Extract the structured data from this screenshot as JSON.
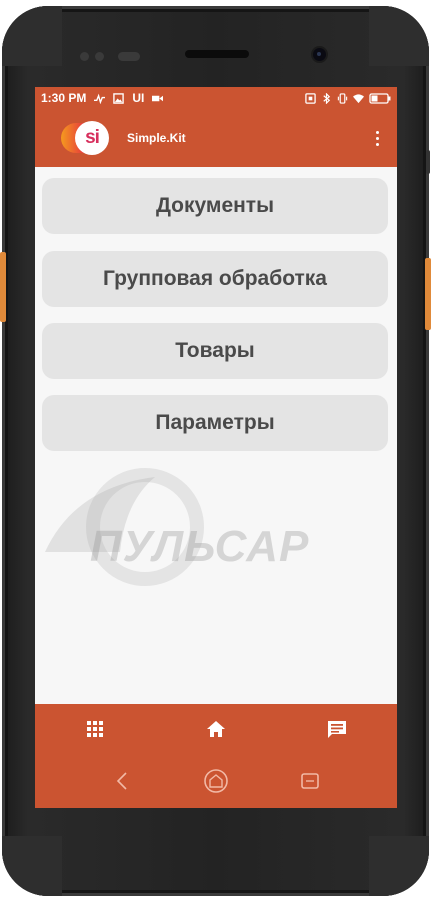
{
  "status_bar": {
    "time": "1:30 PM",
    "ui_label": "UI",
    "icons_left": [
      "activity-icon",
      "image-icon",
      "video-icon"
    ],
    "icons_right": [
      "nfc-icon",
      "bluetooth-icon",
      "vibrate-icon",
      "wifi-icon",
      "battery-icon"
    ]
  },
  "app_bar": {
    "logo_text": "si",
    "title": "Simple.Kit",
    "menu_icon": "more-vert-icon"
  },
  "menu": {
    "items": [
      {
        "label": "Документы"
      },
      {
        "label": "Групповая обработка"
      },
      {
        "label": "Товары"
      },
      {
        "label": "Параметры"
      }
    ]
  },
  "watermark": {
    "text": "ПУЛЬСАР"
  },
  "bottom_nav": {
    "items": [
      {
        "icon": "apps-grid-icon"
      },
      {
        "icon": "home-icon"
      },
      {
        "icon": "chat-icon"
      }
    ]
  },
  "system_nav": {
    "items": [
      {
        "icon": "back-icon"
      },
      {
        "icon": "home-circle-icon"
      },
      {
        "icon": "recents-icon"
      }
    ]
  },
  "colors": {
    "accent": "#cb5431",
    "button_bg": "#e4e4e4",
    "button_text": "#4a4a4a",
    "side_key": "#e08a3a"
  }
}
